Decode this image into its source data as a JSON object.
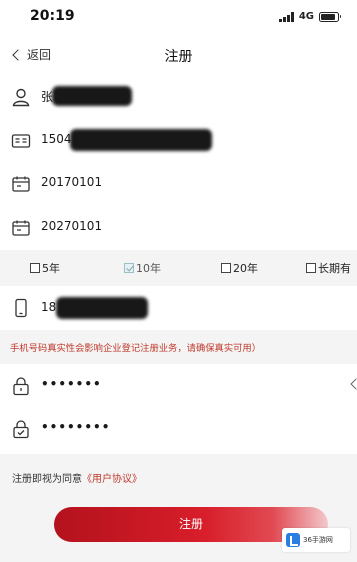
{
  "status_bar": {
    "time": "20:19",
    "network": "4G",
    "battery_level": 0.85
  },
  "nav": {
    "back_label": "返回",
    "title": "注册"
  },
  "form": {
    "name_visible": "张",
    "id_number_visible": "1504",
    "start_date": "20170101",
    "end_date": "20270101"
  },
  "validity": {
    "options": [
      {
        "label": "5年",
        "checked": false
      },
      {
        "label": "10年",
        "checked": true
      },
      {
        "label": "20年",
        "checked": false
      },
      {
        "label": "长期有",
        "checked": false
      }
    ]
  },
  "phone": {
    "visible_prefix": "18",
    "warning": "手机号码真实性会影响企业登记注册业务，请确保真实可用）"
  },
  "password": {
    "masked": "•••••••",
    "confirm_masked": "••••••••"
  },
  "agreement": {
    "prefix": "注册即视为同意",
    "link": "《用户协议》"
  },
  "register_button": {
    "label": "注册"
  },
  "watermark": {
    "text": "36手游网"
  },
  "colors": {
    "accent": "#d81e2a",
    "warning": "#c0392b",
    "background": "#f4f4f5"
  }
}
